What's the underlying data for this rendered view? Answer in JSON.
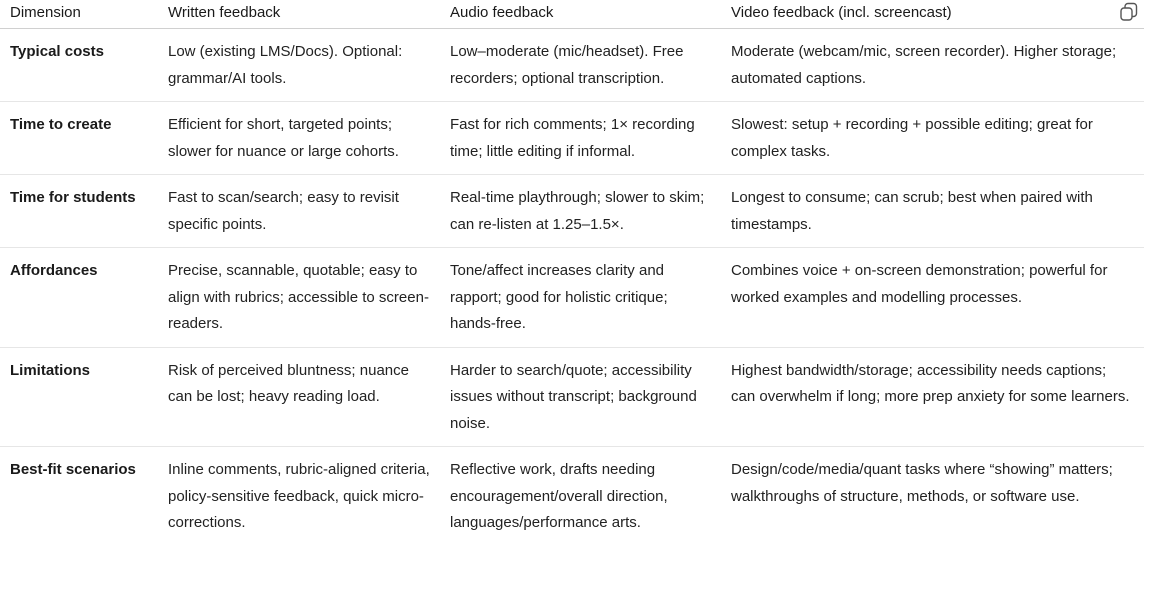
{
  "table": {
    "columns": [
      "Dimension",
      "Written feedback",
      "Audio feedback",
      "Video feedback (incl. screencast)"
    ],
    "rows": [
      [
        "Typical costs",
        "Low (existing LMS/Docs). Optional: grammar/AI tools.",
        "Low–moderate (mic/headset). Free recorders; optional transcription.",
        "Moderate (webcam/mic, screen recorder). Higher storage; automated captions."
      ],
      [
        "Time to create",
        "Efficient for short, targeted points; slower for nuance or large cohorts.",
        "Fast for rich comments; 1× recording time; little editing if informal.",
        "Slowest: setup + recording + possible editing; great for complex tasks."
      ],
      [
        "Time for students",
        "Fast to scan/search; easy to revisit specific points.",
        "Real-time playthrough; slower to skim; can re-listen at 1.25–1.5×.",
        "Longest to consume; can scrub; best when paired with timestamps."
      ],
      [
        "Affordances",
        "Precise, scannable, quotable; easy to align with rubrics; accessible to screen-readers.",
        "Tone/affect increases clarity and rapport; good for holistic critique; hands-free.",
        "Combines voice + on-screen demonstration; powerful for worked examples and modelling processes."
      ],
      [
        "Limitations",
        "Risk of perceived bluntness; nuance can be lost; heavy reading load.",
        "Harder to search/quote; accessibility issues without transcript; background noise.",
        "Highest bandwidth/storage; accessibility needs captions; can overwhelm if long; more prep anxiety for some learners."
      ],
      [
        "Best-fit scenarios",
        "Inline comments, rubric-aligned criteria, policy-sensitive feedback, quick micro-corrections.",
        "Reflective work, drafts needing encouragement/overall direction, languages/performance arts.",
        "Design/code/media/quant tasks where “showing” matters; walkthroughs of structure, methods, or software use."
      ]
    ]
  },
  "toolbar": {
    "copy_icon": "copy-icon"
  }
}
